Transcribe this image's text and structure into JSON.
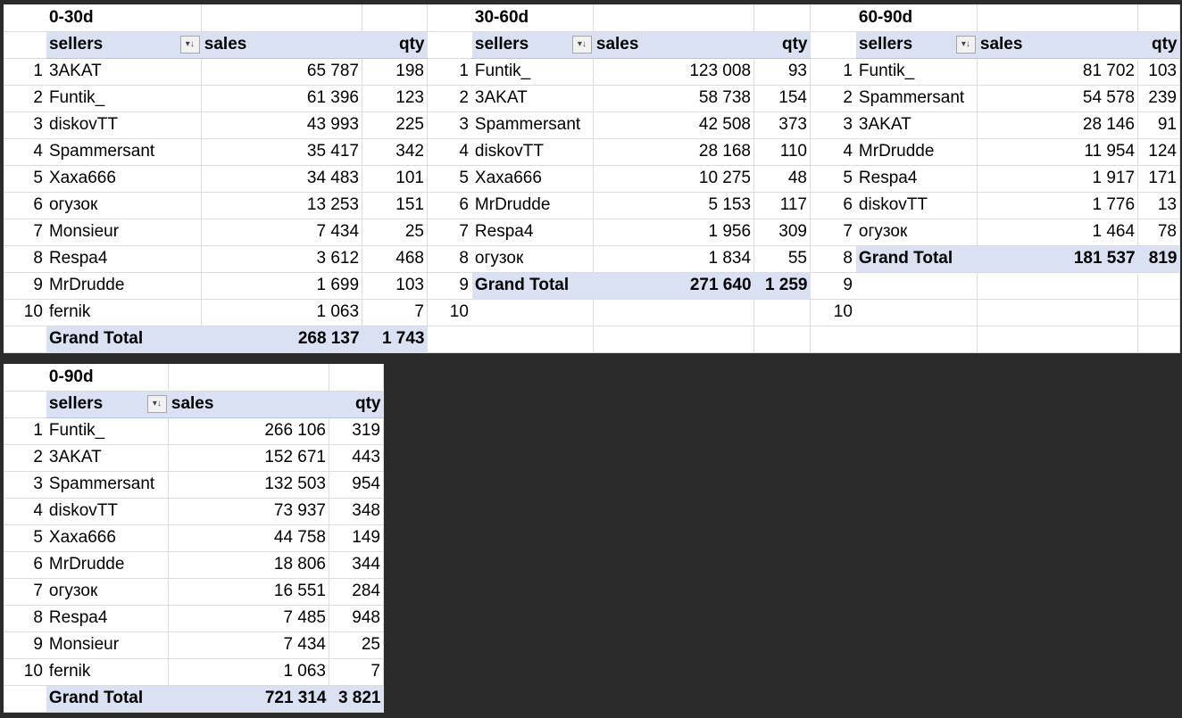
{
  "columns": {
    "sellers": "sellers",
    "sales": "sales",
    "qty": "qty"
  },
  "grand_total_label": "Grand Total",
  "row_numbers": [
    "1",
    "2",
    "3",
    "4",
    "5",
    "6",
    "7",
    "8",
    "9",
    "10"
  ],
  "icons": {
    "filter": "sort-filter-icon"
  },
  "tables": {
    "t030": {
      "title": "0-30d",
      "rows": [
        {
          "seller": "3AKAT",
          "sales": "65 787",
          "qty": "198"
        },
        {
          "seller": "Funtik_",
          "sales": "61 396",
          "qty": "123"
        },
        {
          "seller": "diskovTT",
          "sales": "43 993",
          "qty": "225"
        },
        {
          "seller": "Spammersant",
          "sales": "35 417",
          "qty": "342"
        },
        {
          "seller": "Xaxa666",
          "sales": "34 483",
          "qty": "101"
        },
        {
          "seller": "огузок",
          "sales": "13 253",
          "qty": "151"
        },
        {
          "seller": "Monsieur",
          "sales": "7 434",
          "qty": "25"
        },
        {
          "seller": "Respa4",
          "sales": "3 612",
          "qty": "468"
        },
        {
          "seller": "MrDrudde",
          "sales": "1 699",
          "qty": "103"
        },
        {
          "seller": "fernik",
          "sales": "1 063",
          "qty": "7"
        }
      ],
      "total": {
        "sales": "268 137",
        "qty": "1 743"
      }
    },
    "t3060": {
      "title": "30-60d",
      "rows": [
        {
          "seller": "Funtik_",
          "sales": "123 008",
          "qty": "93"
        },
        {
          "seller": "3AKAT",
          "sales": "58 738",
          "qty": "154"
        },
        {
          "seller": "Spammersant",
          "sales": "42 508",
          "qty": "373"
        },
        {
          "seller": "diskovTT",
          "sales": "28 168",
          "qty": "110"
        },
        {
          "seller": "Xaxa666",
          "sales": "10 275",
          "qty": "48"
        },
        {
          "seller": "MrDrudde",
          "sales": "5 153",
          "qty": "117"
        },
        {
          "seller": "Respa4",
          "sales": "1 956",
          "qty": "309"
        },
        {
          "seller": "огузок",
          "sales": "1 834",
          "qty": "55"
        }
      ],
      "total": {
        "sales": "271 640",
        "qty": "1 259"
      }
    },
    "t6090": {
      "title": "60-90d",
      "rows": [
        {
          "seller": "Funtik_",
          "sales": "81 702",
          "qty": "103"
        },
        {
          "seller": "Spammersant",
          "sales": "54 578",
          "qty": "239"
        },
        {
          "seller": "3AKAT",
          "sales": "28 146",
          "qty": "91"
        },
        {
          "seller": "MrDrudde",
          "sales": "11 954",
          "qty": "124"
        },
        {
          "seller": "Respa4",
          "sales": "1 917",
          "qty": "171"
        },
        {
          "seller": "diskovTT",
          "sales": "1 776",
          "qty": "13"
        },
        {
          "seller": "огузок",
          "sales": "1 464",
          "qty": "78"
        }
      ],
      "total": {
        "sales": "181 537",
        "qty": "819"
      }
    },
    "t090": {
      "title": "0-90d",
      "rows": [
        {
          "seller": "Funtik_",
          "sales": "266 106",
          "qty": "319"
        },
        {
          "seller": "3AKAT",
          "sales": "152 671",
          "qty": "443"
        },
        {
          "seller": "Spammersant",
          "sales": "132 503",
          "qty": "954"
        },
        {
          "seller": "diskovTT",
          "sales": "73 937",
          "qty": "348"
        },
        {
          "seller": "Xaxa666",
          "sales": "44 758",
          "qty": "149"
        },
        {
          "seller": "MrDrudde",
          "sales": "18 806",
          "qty": "344"
        },
        {
          "seller": "огузок",
          "sales": "16 551",
          "qty": "284"
        },
        {
          "seller": "Respa4",
          "sales": "7 485",
          "qty": "948"
        },
        {
          "seller": "Monsieur",
          "sales": "7 434",
          "qty": "25"
        },
        {
          "seller": "fernik",
          "sales": "1 063",
          "qty": "7"
        }
      ],
      "total": {
        "sales": "721 314",
        "qty": "3 821"
      }
    }
  }
}
